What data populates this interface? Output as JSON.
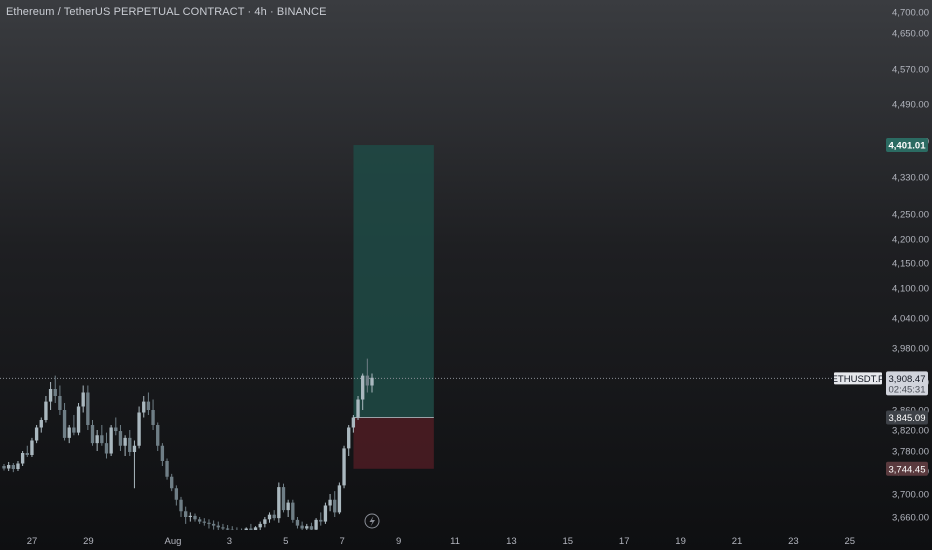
{
  "header": {
    "title": "Ethereum / TetherUS PERPETUAL CONTRACT · 4h · BINANCE"
  },
  "chart_data": {
    "type": "candlestick",
    "price_axis": {
      "ticks": [
        3660,
        3700,
        3740,
        3780,
        3820,
        3860,
        3900,
        3980,
        4040,
        4100,
        4150,
        4200,
        4250,
        4330,
        4410,
        4490,
        4570,
        4650,
        4700
      ],
      "tick_labels": [
        "3,660.00",
        "3,700.00",
        "3,740.00",
        "3,780.00",
        "3,820.00",
        "3,860.00",
        "3,900.00",
        "3,980.00",
        "4,040.00",
        "4,100.00",
        "4,150.00",
        "4,200.00",
        "4,250.00",
        "4,330.00",
        "4,410.00",
        "4,490.00",
        "4,570.00",
        "4,650.00",
        "4,700.00"
      ]
    },
    "time_axis": {
      "labels": [
        "27",
        "29",
        "Aug",
        "3",
        "5",
        "7",
        "9",
        "11",
        "13",
        "15",
        "17",
        "19",
        "21",
        "23",
        "25"
      ],
      "day_index": [
        0,
        2,
        5,
        7,
        9,
        11,
        13,
        15,
        17,
        19,
        21,
        23,
        25,
        27,
        29
      ]
    },
    "candles": [
      [
        3750,
        3754,
        3741,
        3745
      ],
      [
        3745,
        3758,
        3740,
        3752
      ],
      [
        3752,
        3756,
        3738,
        3744
      ],
      [
        3744,
        3760,
        3740,
        3755
      ],
      [
        3755,
        3780,
        3750,
        3776
      ],
      [
        3776,
        3790,
        3768,
        3772
      ],
      [
        3772,
        3805,
        3768,
        3800
      ],
      [
        3800,
        3830,
        3795,
        3825
      ],
      [
        3825,
        3845,
        3815,
        3840
      ],
      [
        3840,
        3880,
        3835,
        3872
      ],
      [
        3872,
        3900,
        3860,
        3890
      ],
      [
        3890,
        3915,
        3870,
        3880
      ],
      [
        3880,
        3895,
        3850,
        3860
      ],
      [
        3860,
        3870,
        3800,
        3805
      ],
      [
        3805,
        3830,
        3795,
        3825
      ],
      [
        3825,
        3850,
        3810,
        3815
      ],
      [
        3815,
        3870,
        3810,
        3865
      ],
      [
        3865,
        3895,
        3855,
        3885
      ],
      [
        3885,
        3895,
        3820,
        3830
      ],
      [
        3830,
        3840,
        3790,
        3795
      ],
      [
        3795,
        3820,
        3780,
        3810
      ],
      [
        3810,
        3830,
        3790,
        3795
      ],
      [
        3795,
        3815,
        3765,
        3775
      ],
      [
        3775,
        3830,
        3770,
        3825
      ],
      [
        3825,
        3845,
        3810,
        3818
      ],
      [
        3818,
        3830,
        3780,
        3790
      ],
      [
        3790,
        3810,
        3770,
        3805
      ],
      [
        3805,
        3820,
        3770,
        3778
      ],
      [
        3778,
        3800,
        3710,
        3790
      ],
      [
        3790,
        3865,
        3785,
        3855
      ],
      [
        3855,
        3880,
        3845,
        3872
      ],
      [
        3872,
        3885,
        3850,
        3860
      ],
      [
        3860,
        3875,
        3820,
        3830
      ],
      [
        3830,
        3835,
        3780,
        3790
      ],
      [
        3790,
        3795,
        3750,
        3760
      ],
      [
        3760,
        3765,
        3725,
        3730
      ],
      [
        3730,
        3735,
        3705,
        3710
      ],
      [
        3710,
        3715,
        3680,
        3690
      ],
      [
        3690,
        3695,
        3660,
        3670
      ],
      [
        3670,
        3678,
        3648,
        3660
      ],
      [
        3660,
        3668,
        3652,
        3662
      ],
      [
        3662,
        3666,
        3652,
        3656
      ],
      [
        3656,
        3660,
        3648,
        3652
      ],
      [
        3652,
        3658,
        3645,
        3650
      ],
      [
        3650,
        3656,
        3640,
        3648
      ],
      [
        3648,
        3654,
        3638,
        3645
      ],
      [
        3645,
        3652,
        3635,
        3642
      ],
      [
        3642,
        3648,
        3632,
        3640
      ],
      [
        3640,
        3646,
        3630,
        3638
      ],
      [
        3638,
        3644,
        3628,
        3635
      ],
      [
        3635,
        3642,
        3626,
        3633
      ],
      [
        3633,
        3640,
        3625,
        3632
      ],
      [
        3632,
        3642,
        3626,
        3640
      ],
      [
        3640,
        3648,
        3632,
        3636
      ],
      [
        3636,
        3644,
        3628,
        3642
      ],
      [
        3642,
        3652,
        3636,
        3648
      ],
      [
        3648,
        3660,
        3642,
        3656
      ],
      [
        3656,
        3668,
        3650,
        3664
      ],
      [
        3664,
        3672,
        3654,
        3658
      ],
      [
        3658,
        3720,
        3650,
        3712
      ],
      [
        3712,
        3718,
        3668,
        3672
      ],
      [
        3672,
        3690,
        3660,
        3685
      ],
      [
        3685,
        3690,
        3650,
        3655
      ],
      [
        3655,
        3660,
        3640,
        3645
      ],
      [
        3645,
        3652,
        3630,
        3640
      ],
      [
        3640,
        3648,
        3632,
        3644
      ],
      [
        3644,
        3650,
        3630,
        3638
      ],
      [
        3638,
        3658,
        3633,
        3655
      ],
      [
        3655,
        3668,
        3645,
        3652
      ],
      [
        3652,
        3685,
        3648,
        3680
      ],
      [
        3680,
        3700,
        3670,
        3690
      ],
      [
        3690,
        3705,
        3660,
        3668
      ],
      [
        3668,
        3720,
        3665,
        3715
      ],
      [
        3715,
        3790,
        3710,
        3785
      ],
      [
        3785,
        3830,
        3770,
        3825
      ],
      [
        3825,
        3850,
        3815,
        3845
      ],
      [
        3845,
        3880,
        3840,
        3875
      ],
      [
        3875,
        3920,
        3860,
        3915
      ],
      [
        3915,
        3955,
        3885,
        3895
      ],
      [
        3895,
        3920,
        3885,
        3910
      ]
    ],
    "last_price": {
      "symbol": "ETHUSDT.P",
      "price": 3908.47,
      "price_label": "3,908.47",
      "countdown": "02:45:31"
    },
    "position_tool": {
      "type": "long",
      "entry": 3845.09,
      "entry_label": "3,845.09",
      "take_profit": 4401.01,
      "take_profit_label": "4,401.01",
      "stop_loss": 3744.45,
      "stop_loss_label": "3,744.45",
      "start_day": 11.4,
      "end_day": 14.25
    },
    "colors": {
      "up": "#089981",
      "down": "#f23645",
      "candle_up": "#aab8bf",
      "candle_down": "#6f7e86",
      "profit_zone": "#1f4a45",
      "loss_zone": "#4a1c22",
      "tp_tag": "#2b6b62",
      "sl_tag": "#5a3a3e",
      "price_tag": "#d1d4dc"
    },
    "grid": false
  }
}
